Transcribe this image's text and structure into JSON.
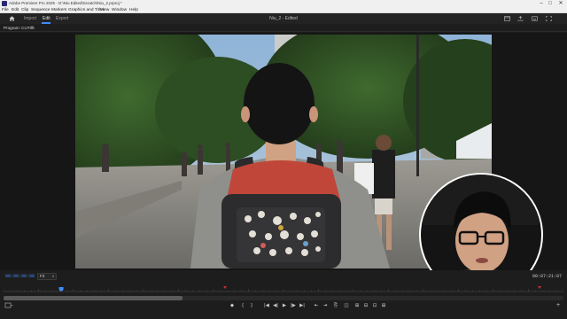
{
  "titlebar": {
    "title": "Adobe Premiere Pro 2025 - D:\\Niu Edited\\Scratch\\Niu_2.prproj *",
    "minimize": "–",
    "maximize": "□",
    "close": "✕"
  },
  "menubar": {
    "items": [
      "File",
      "Edit",
      "Clip",
      "Sequence",
      "Markers",
      "Graphics and Titles",
      "View",
      "Window",
      "Help"
    ]
  },
  "header": {
    "tabs": [
      "Import",
      "Edit",
      "Export"
    ],
    "active_tab": "Edit",
    "project_title": "Niu_2 - Edited"
  },
  "program_panel": {
    "tab_label": "Program: CUT08",
    "menu_glyph": "≡"
  },
  "controls": {
    "current_timecode": "00:00:00:08",
    "fit_value": "Fit",
    "duration_timecode": "00:07:21:07",
    "add_glyph": "+",
    "playhead_fraction": 0.103,
    "scroll_thumb_fraction": 0.32,
    "transport_glyphs": [
      "◆",
      "{",
      "}",
      "|◀",
      "◀|",
      "▶",
      "|▶",
      "▶|",
      "⇤",
      "⇥",
      "⎘",
      "◫",
      "⊞",
      "⊟",
      "⊡",
      "⊞"
    ]
  },
  "colors": {
    "accent": "#3f8cff",
    "playhead": "#3f8cff",
    "marker_red": "#d62d2d"
  }
}
